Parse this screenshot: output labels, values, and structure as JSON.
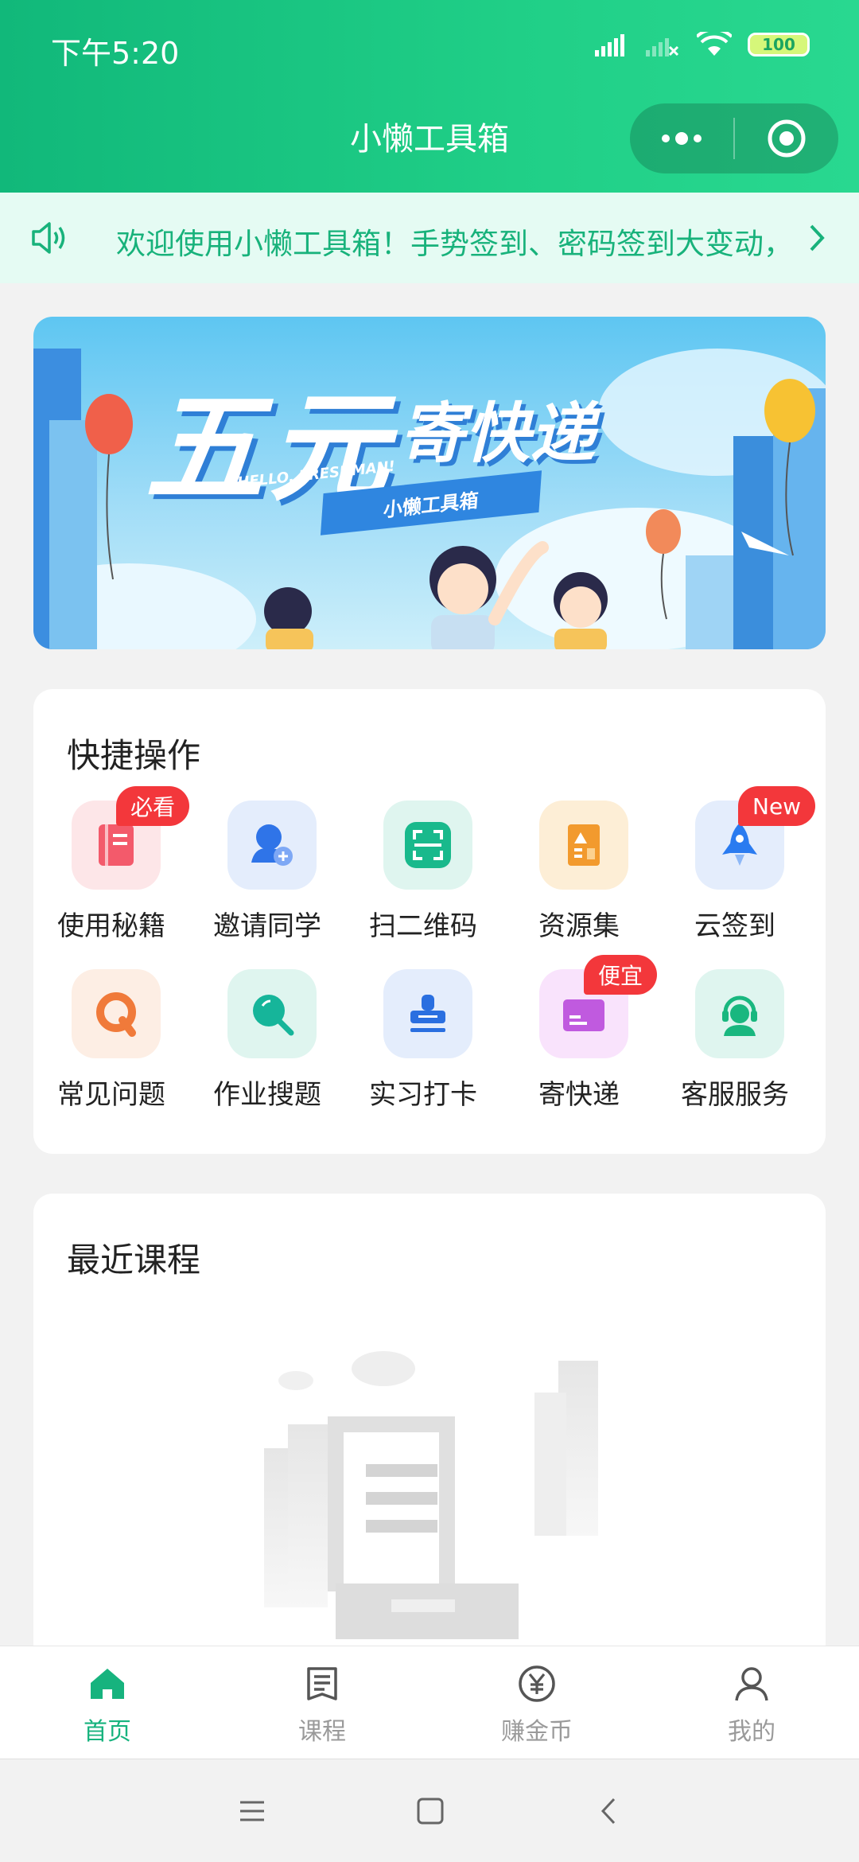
{
  "status": {
    "time": "下午5:20",
    "battery": "100"
  },
  "header": {
    "title": "小懒工具箱"
  },
  "notice": {
    "text": "欢迎使用小懒工具箱！手势签到、密码签到大变动，"
  },
  "banner": {
    "title_main": "五元",
    "title_sub": "寄快递",
    "hello": "HELLO, FRESHMAN!",
    "tag": "小懒工具箱"
  },
  "quick_actions": {
    "title": "快捷操作",
    "items": [
      {
        "label": "使用秘籍",
        "badge": "必看",
        "icon": "book-icon",
        "color": "#f35a6b"
      },
      {
        "label": "邀请同学",
        "badge": "",
        "icon": "invite-user-icon",
        "color": "#2f74e8"
      },
      {
        "label": "扫二维码",
        "badge": "",
        "icon": "scan-qr-icon",
        "color": "#19b98c"
      },
      {
        "label": "资源集",
        "badge": "",
        "icon": "resources-icon",
        "color": "#f29a2e"
      },
      {
        "label": "云签到",
        "badge": "New",
        "icon": "rocket-icon",
        "color": "#2a7bf0"
      },
      {
        "label": "常见问题",
        "badge": "",
        "icon": "faq-icon",
        "color": "#f07a3a"
      },
      {
        "label": "作业搜题",
        "badge": "",
        "icon": "search-icon",
        "color": "#16b59a"
      },
      {
        "label": "实习打卡",
        "badge": "",
        "icon": "stamp-icon",
        "color": "#2a6fe0"
      },
      {
        "label": "寄快递",
        "badge": "便宜",
        "icon": "package-icon",
        "color": "#c05adf"
      },
      {
        "label": "客服服务",
        "badge": "",
        "icon": "customer-service-icon",
        "color": "#19b77f"
      }
    ]
  },
  "recent": {
    "title": "最近课程"
  },
  "tabbar": [
    {
      "label": "首页",
      "icon": "home-icon",
      "active": true
    },
    {
      "label": "课程",
      "icon": "course-icon",
      "active": false
    },
    {
      "label": "赚金币",
      "icon": "coin-icon",
      "active": false
    },
    {
      "label": "我的",
      "icon": "profile-icon",
      "active": false
    }
  ],
  "colors": {
    "primary": "#17b37e",
    "badge": "#f3373b"
  }
}
